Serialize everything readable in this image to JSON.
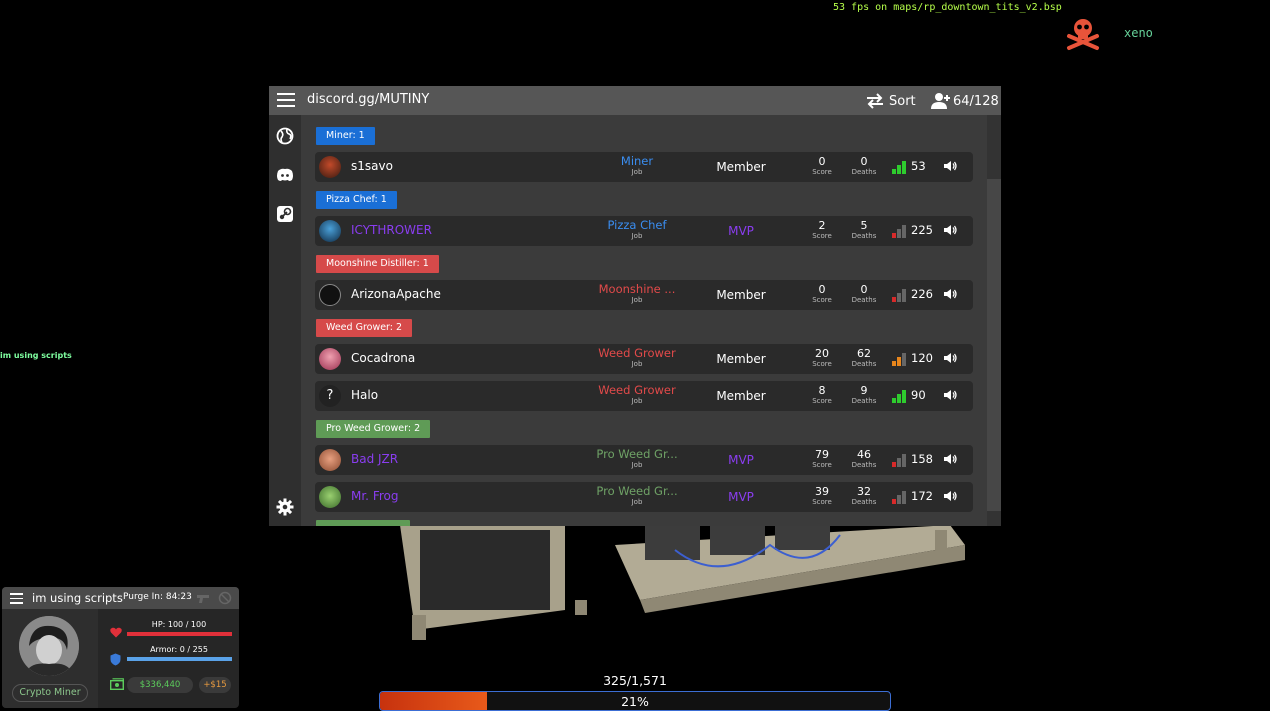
{
  "overlay": {
    "fps_text": "53 fps on maps/rp_downtown_tits_v2.bsp",
    "brand_name": "xeno",
    "side_text": "im using scripts"
  },
  "scoreboard": {
    "server_name": "discord.gg/MUTINY",
    "sort_label": "Sort",
    "player_count": "64/128",
    "stat_labels": {
      "job": "Job",
      "score": "Score",
      "deaths": "Deaths"
    },
    "groups": [
      {
        "label": "Miner: 1",
        "color": "#1a6fd6"
      },
      {
        "label": "Pizza Chef: 1",
        "color": "#1a6fd6"
      },
      {
        "label": "Moonshine Distiller: 1",
        "color": "#d64a4a"
      },
      {
        "label": "Weed Grower: 2",
        "color": "#d64a4a"
      },
      {
        "label": "Pro Weed Grower: 2",
        "color": "#5f9b56"
      }
    ],
    "players": [
      {
        "name": "s1savo",
        "name_color": "#ffffff",
        "job": "Miner",
        "job_color": "#3a8df0",
        "rank": "Member",
        "rank_color": "#ffffff",
        "score": "0",
        "deaths": "0",
        "ping": "53",
        "ping_level": 3
      },
      {
        "name": "ICYTHROWER",
        "name_color": "#8a3df0",
        "job": "Pizza Chef",
        "job_color": "#3a8df0",
        "rank": "MVP",
        "rank_color": "#8a3df0",
        "score": "2",
        "deaths": "5",
        "ping": "225",
        "ping_level": 1
      },
      {
        "name": "ArizonaApache",
        "name_color": "#ffffff",
        "job": "Moonshine ...",
        "job_color": "#e24a4a",
        "rank": "Member",
        "rank_color": "#ffffff",
        "score": "0",
        "deaths": "0",
        "ping": "226",
        "ping_level": 1
      },
      {
        "name": "Cocadrona",
        "name_color": "#ffffff",
        "job": "Weed Grower",
        "job_color": "#e24a4a",
        "rank": "Member",
        "rank_color": "#ffffff",
        "score": "20",
        "deaths": "62",
        "ping": "120",
        "ping_level": 2
      },
      {
        "name": "Halo",
        "name_color": "#ffffff",
        "job": "Weed Grower",
        "job_color": "#e24a4a",
        "rank": "Member",
        "rank_color": "#ffffff",
        "score": "8",
        "deaths": "9",
        "ping": "90",
        "ping_level": 3
      },
      {
        "name": "Bad JZR",
        "name_color": "#8a3df0",
        "job": "Pro Weed Gr...",
        "job_color": "#6fa266",
        "rank": "MVP",
        "rank_color": "#8a3df0",
        "score": "79",
        "deaths": "46",
        "ping": "158",
        "ping_level": 1
      },
      {
        "name": "Mr. Frog",
        "name_color": "#8a3df0",
        "job": "Pro Weed Gr...",
        "job_color": "#6fa266",
        "rank": "MVP",
        "rank_color": "#8a3df0",
        "score": "39",
        "deaths": "32",
        "ping": "172",
        "ping_level": 1
      }
    ]
  },
  "hud": {
    "name": "im using scripts",
    "purge": "Purge  In: 84:23",
    "job": "Crypto Miner",
    "hp_text": "HP: 100 / 100",
    "hp_fraction": 1.0,
    "armor_text": "Armor: 0 / 255",
    "armor_fraction": 0.0,
    "money": "$336,440",
    "income": "+$15",
    "colors": {
      "hp": "#e0303a",
      "armor": "#5aa2e8",
      "money": "#5ccd5c"
    }
  },
  "xp": {
    "progress_text": "325/1,571",
    "percent_text": "21%",
    "fraction": 0.21
  }
}
